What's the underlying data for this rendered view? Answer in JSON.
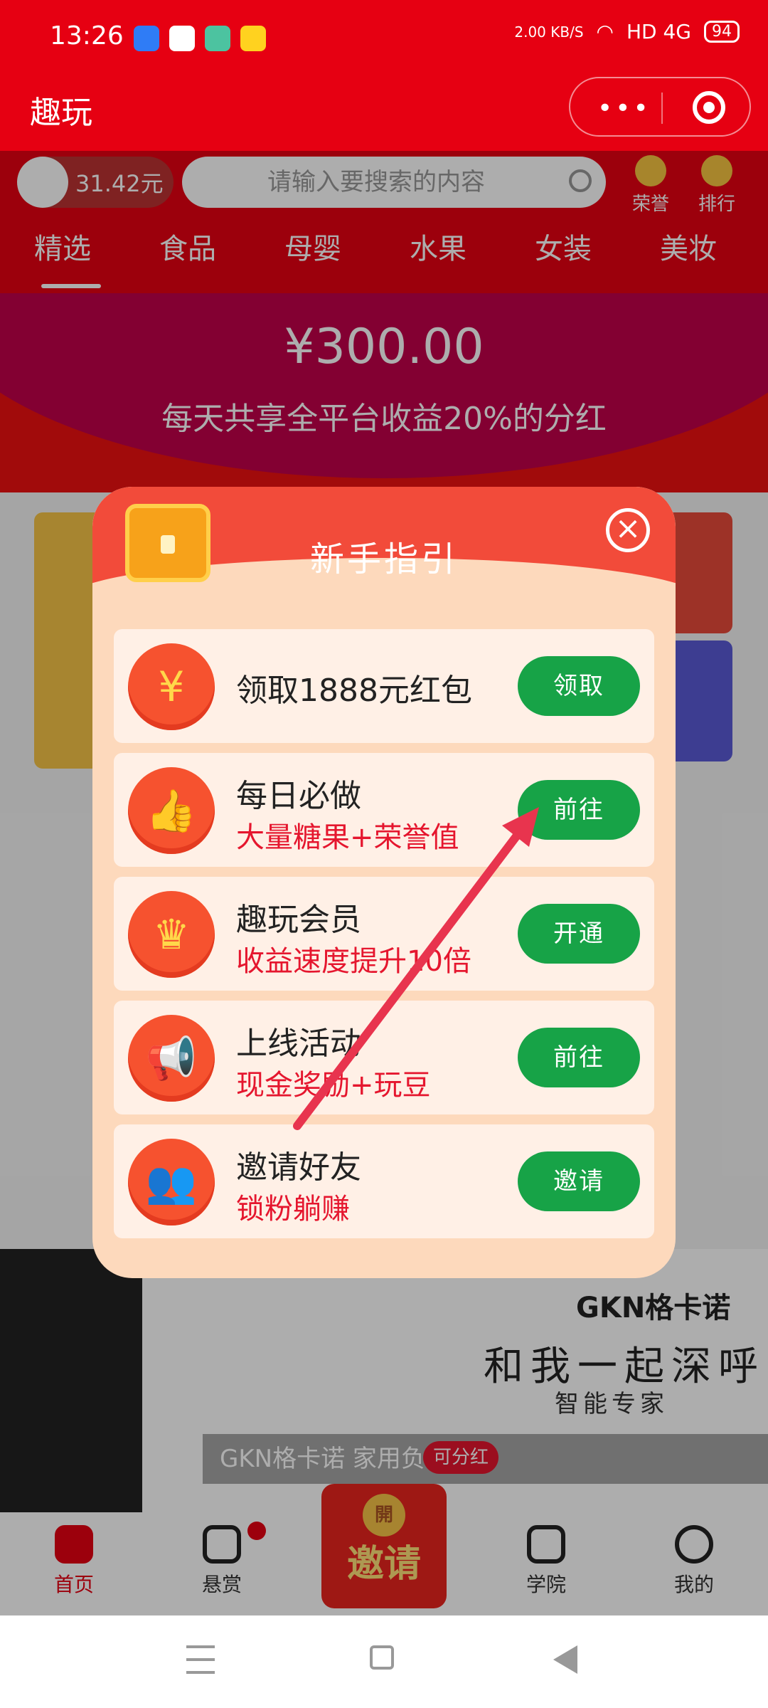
{
  "status_bar": {
    "time": "13:26",
    "speed": "2.00 KB/S",
    "network": "HD 4G",
    "battery": "94"
  },
  "header": {
    "title": "趣玩"
  },
  "top": {
    "balance": "31.42元",
    "search_placeholder": "请输入要搜索的内容",
    "honor": "荣誉",
    "rank": "排行"
  },
  "categories": [
    "精选",
    "食品",
    "母婴",
    "水果",
    "女装",
    "美妆"
  ],
  "banner": {
    "amount": "¥300.00",
    "slogan": "每天共享全平台收益20%的分红"
  },
  "bottom_banner": {
    "brand": "GKN格卡诺",
    "tagline": "和我一起深呼",
    "sub": "智能专家",
    "caption": "GKN格卡诺 家用负离子…",
    "share_badge": "可分红"
  },
  "modal": {
    "title": "新手指引",
    "tasks": [
      {
        "icon": "red-packet-icon",
        "title": "领取1888元红包",
        "subtitle": "",
        "button": "领取"
      },
      {
        "icon": "thumbs-up-icon",
        "title": "每日必做",
        "subtitle": "大量糖果+荣誉值",
        "button": "前往"
      },
      {
        "icon": "crown-icon",
        "title": "趣玩会员",
        "subtitle": "收益速度提升10倍",
        "button": "开通"
      },
      {
        "icon": "megaphone-icon",
        "title": "上线活动",
        "subtitle": "现金奖励+玩豆",
        "button": "前往"
      },
      {
        "icon": "friends-icon",
        "title": "邀请好友",
        "subtitle": "锁粉躺赚",
        "button": "邀请"
      }
    ]
  },
  "tabbar": {
    "home": "首页",
    "reward": "悬赏",
    "invite": "邀请",
    "invite_seal": "開",
    "academy": "学院",
    "mine": "我的"
  },
  "colors": {
    "brand_red": "#e60012",
    "button_green": "#17a347",
    "modal_bg": "#fdd9bc",
    "arrow": "#e8344e"
  }
}
